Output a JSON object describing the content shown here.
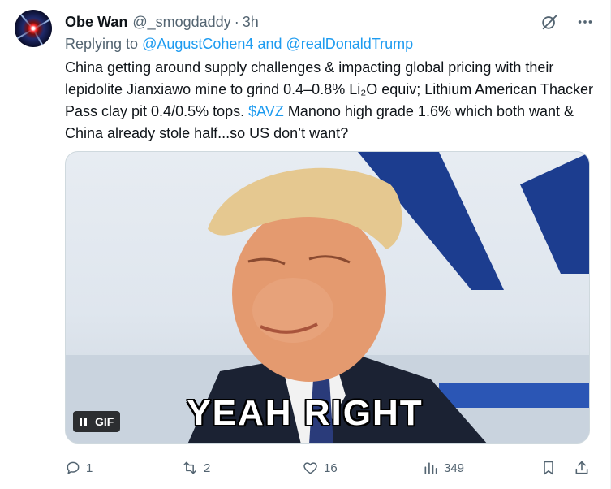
{
  "tweet": {
    "author_name": "Obe Wan",
    "author_handle": "@_smogdaddy",
    "separator": "·",
    "time": "3h",
    "replying_prefix": "Replying to ",
    "replying_mention_1": "@AugustCohen4",
    "replying_and": " and ",
    "replying_mention_2": "@realDonaldTrump",
    "text_part_1": "China getting around supply challenges & impacting global pricing with their lepidolite Jianxiawo mine to grind 0.4–0.8% Li₂O equiv; Lithium American Thacker Pass clay pit 0.4/0.5% tops. ",
    "cashtag": "$AVZ",
    "text_part_2": " Manono high grade 1.6% which both want & China already stole half...so US don’t want?"
  },
  "media": {
    "caption": "YEAH RIGHT",
    "badge_label": "GIF",
    "pause_icon": "pause-icon"
  },
  "actions": {
    "reply_count": "1",
    "repost_count": "2",
    "like_count": "16",
    "views_count": "349"
  },
  "colors": {
    "accent": "#1d9bf0",
    "secondary_text": "#536471",
    "primary_text": "#0f1419"
  },
  "icons": [
    "grok-icon",
    "more-icon",
    "reply-icon",
    "repost-icon",
    "like-icon",
    "views-icon",
    "bookmark-icon",
    "share-icon"
  ]
}
